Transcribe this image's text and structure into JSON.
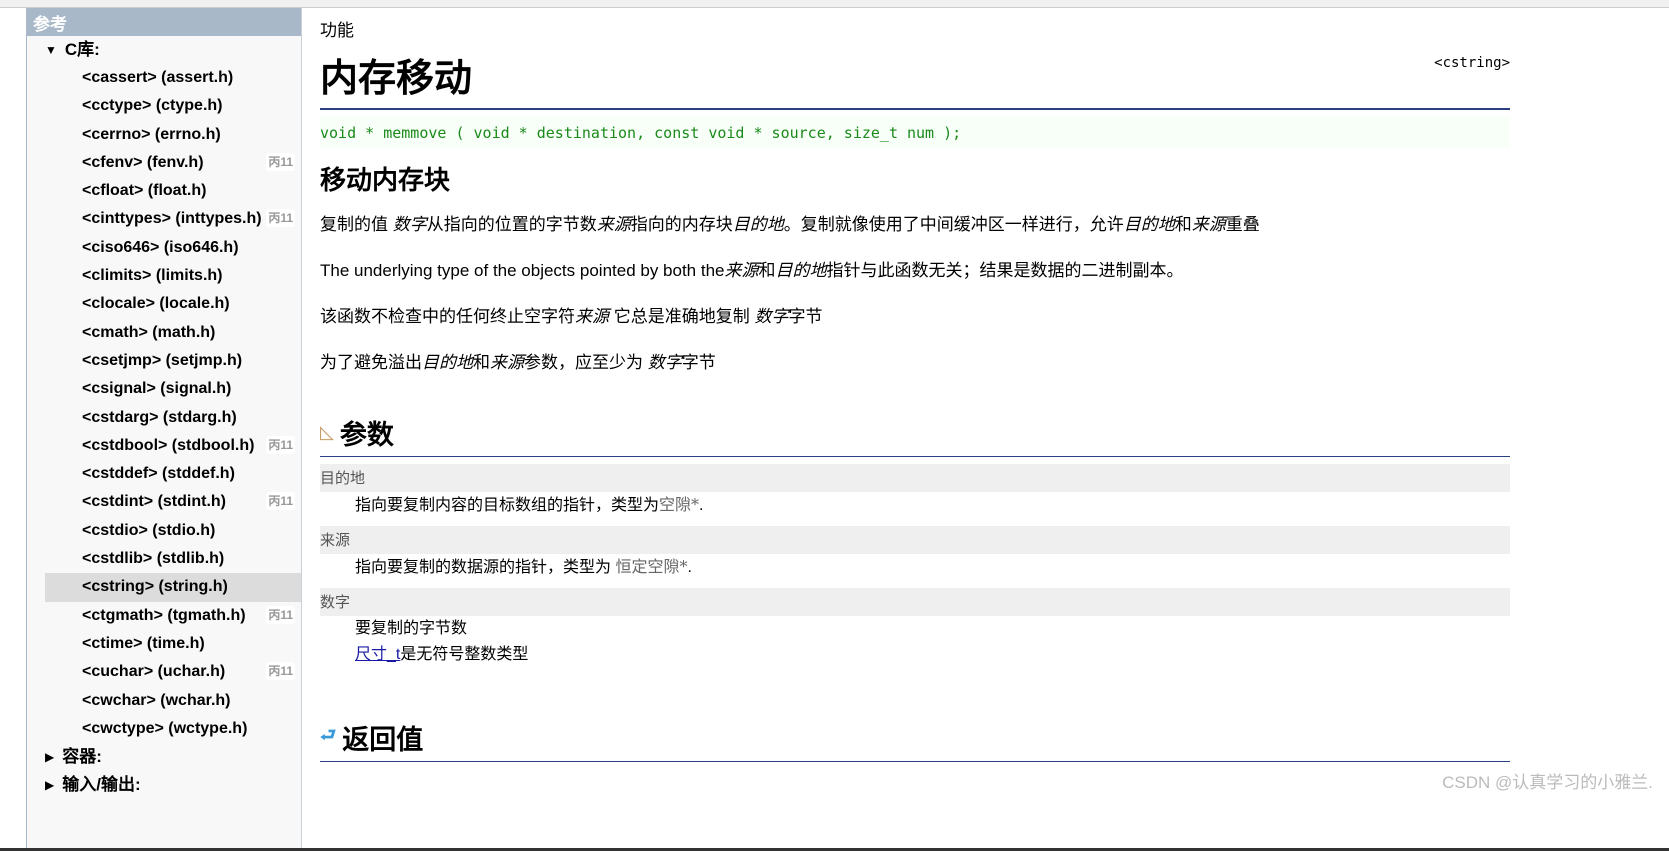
{
  "sidebar": {
    "header": "参考",
    "category": "C库:",
    "items": [
      {
        "label": "<cassert> (assert.h)"
      },
      {
        "label": "<cctype> (ctype.h)"
      },
      {
        "label": "<cerrno> (errno.h)"
      },
      {
        "label": "<cfenv> (fenv.h)",
        "badge": "丙11"
      },
      {
        "label": "<cfloat> (float.h)"
      },
      {
        "label": "<cinttypes> (inttypes.h)",
        "badge": "丙11"
      },
      {
        "label": "<ciso646> (iso646.h)"
      },
      {
        "label": "<climits> (limits.h)"
      },
      {
        "label": "<clocale> (locale.h)"
      },
      {
        "label": "<cmath> (math.h)"
      },
      {
        "label": "<csetjmp> (setjmp.h)"
      },
      {
        "label": "<csignal> (signal.h)"
      },
      {
        "label": "<cstdarg> (stdarg.h)"
      },
      {
        "label": "<cstdbool> (stdbool.h)",
        "badge": "丙11"
      },
      {
        "label": "<cstddef> (stddef.h)"
      },
      {
        "label": "<cstdint> (stdint.h)",
        "badge": "丙11"
      },
      {
        "label": "<cstdio> (stdio.h)"
      },
      {
        "label": "<cstdlib> (stdlib.h)"
      },
      {
        "label": "<cstring> (string.h)",
        "selected": true
      },
      {
        "label": "<ctgmath> (tgmath.h)",
        "badge": "丙11"
      },
      {
        "label": "<ctime> (time.h)"
      },
      {
        "label": "<cuchar> (uchar.h)",
        "badge": "丙11"
      },
      {
        "label": "<cwchar> (wchar.h)"
      },
      {
        "label": "<cwctype> (wctype.h)"
      }
    ],
    "collapsed": [
      "容器:",
      "输入/输出:"
    ]
  },
  "main": {
    "kicker": "功能",
    "title": "内存移动",
    "header_lib": "<cstring>",
    "prototype": "void * memmove ( void * destination, const void * source, size_t num );",
    "subtitle": "移动内存块",
    "paragraphs": [
      [
        {
          "t": "复制的值 "
        },
        {
          "t": "数字",
          "i": 1
        },
        {
          "t": "从指向的位置的字节数"
        },
        {
          "t": "来源",
          "i": 1
        },
        {
          "t": "指向的内存块"
        },
        {
          "t": "目的地",
          "i": 1
        },
        {
          "t": "。复制就像使用了中间缓冲区一样进行，允许"
        },
        {
          "t": "目的地",
          "i": 1
        },
        {
          "t": "和"
        },
        {
          "t": "来源",
          "i": 1
        },
        {
          "t": "重叠"
        }
      ],
      [
        {
          "t": "The underlying type of the objects pointed by both the"
        },
        {
          "t": "来源",
          "i": 1
        },
        {
          "t": "和"
        },
        {
          "t": "目的地",
          "i": 1
        },
        {
          "t": "指针与此函数无关；结果是数据的二进制副本。"
        }
      ],
      [
        {
          "t": "该函数不检查中的任何终止空字符"
        },
        {
          "t": "来源",
          "i": 1
        },
        {
          "t": " 它总是准确地复制 "
        },
        {
          "t": "数字",
          "i": 1
        },
        {
          "t": "字节"
        }
      ],
      [
        {
          "t": "为了避免溢出"
        },
        {
          "t": "目的地",
          "i": 1
        },
        {
          "t": "和"
        },
        {
          "t": "来源",
          "i": 1
        },
        {
          "t": "参数，应至少为 "
        },
        {
          "t": "数字",
          "i": 1
        },
        {
          "t": "字节"
        }
      ]
    ],
    "params_title": "参数",
    "params": [
      {
        "name": "目的地",
        "desc": "指向要复制内容的目标数组的指针，类型为",
        "type": "空隙*",
        "end": "."
      },
      {
        "name": "来源",
        "desc": "指向要复制的数据源的指针，类型为 ",
        "type": "恒定空隙*",
        "end": "."
      },
      {
        "name": "数字",
        "desc": "要复制的字节数",
        "link": "尺寸_t",
        "desc2": "是无符号整数类型"
      }
    ],
    "return_title": "返回值"
  },
  "watermark": "CSDN @认真学习的小雅兰."
}
